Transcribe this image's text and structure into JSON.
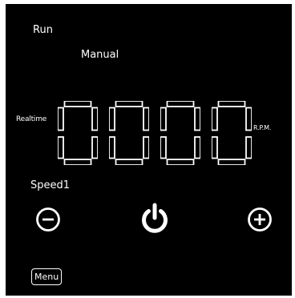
{
  "status_text": "Run",
  "mode_text": "Manual",
  "realtime_label": "Realtime",
  "rpm_value": "0000",
  "rpm_unit": "R.P.M.",
  "speed_label": "Speed1",
  "controls": {
    "decrease_icon": "minus-circle-icon",
    "power_icon": "power-icon",
    "increase_icon": "plus-circle-icon"
  },
  "menu_label": "Menu",
  "colors": {
    "background": "#000000",
    "foreground": "#ffffff",
    "frame": "#ffffff"
  }
}
